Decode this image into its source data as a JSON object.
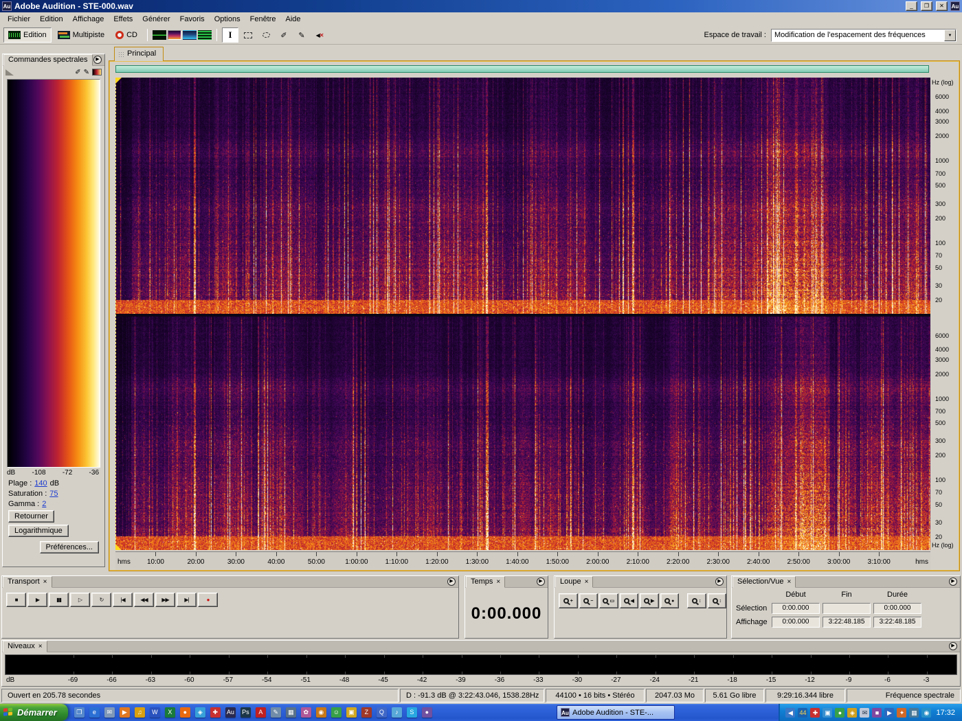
{
  "colors": {
    "frame_accent": "#c28a10",
    "range_bar_green": "#7fcab4",
    "selection_yellow": "#ffd820",
    "record_red": "#cc1111",
    "taskbar_blue": "#2c60d8",
    "start_green": "#2f8a2c",
    "spectro_palette": [
      "#040008",
      "#1c0430",
      "#44085c",
      "#8c1448",
      "#c82828",
      "#f07018",
      "#f8a820",
      "#ffd850",
      "#fff8dc"
    ]
  },
  "window": {
    "icon": "Au",
    "title": "Adobe Audition - STE-000.wav"
  },
  "icons": {
    "minimize": "_",
    "maximize": "❐",
    "close": "✕",
    "panel_menu": "▶",
    "tab_close": "×",
    "dropdown_arrow": "▼",
    "eyedropper_add": "✐",
    "eyedropper_remove": "✎",
    "transport": [
      {
        "name": "stop-button",
        "glyph": "■"
      },
      {
        "name": "play-button",
        "glyph": "▶"
      },
      {
        "name": "pause-button",
        "glyph": "▮▮"
      },
      {
        "name": "play-from-cursor-button",
        "glyph": "▷"
      },
      {
        "name": "play-looped-button",
        "glyph": "↻"
      },
      {
        "name": "go-to-beginning-button",
        "glyph": "|◀"
      },
      {
        "name": "rewind-button",
        "glyph": "◀◀"
      },
      {
        "name": "fast-forward-button",
        "glyph": "▶▶"
      },
      {
        "name": "go-to-end-button",
        "glyph": "▶|"
      },
      {
        "name": "record-button",
        "glyph": "●",
        "fg": "#cc1111"
      }
    ],
    "loupe": [
      {
        "name": "zoom-in-button",
        "sign": "+"
      },
      {
        "name": "zoom-out-button",
        "sign": "−"
      },
      {
        "name": "zoom-full-button",
        "sign": "▭"
      },
      {
        "name": "zoom-left-edge-button",
        "sign": "◀"
      },
      {
        "name": "zoom-right-edge-button",
        "sign": "▶"
      },
      {
        "name": "zoom-selection-button",
        "sign": "●"
      },
      {
        "name": "zoom-in-vertical-button",
        "sign": "↕"
      },
      {
        "name": "zoom-out-vertical-button",
        "sign": "↕"
      }
    ]
  },
  "menu": {
    "items": [
      "Fichier",
      "Edition",
      "Affichage",
      "Effets",
      "Générer",
      "Favoris",
      "Options",
      "Fenêtre",
      "Aide"
    ]
  },
  "toolbar": {
    "buttons": [
      "Edition",
      "Multipiste",
      "CD"
    ],
    "workspace_label": "Espace de travail :",
    "workspace_value": "Modification de l'espacement des fréquences"
  },
  "spectral_controls": {
    "title": "Commandes spectrales",
    "scale_labels": [
      "dB",
      "-108",
      "-72",
      "-36"
    ],
    "fields": [
      {
        "label": "Plage :",
        "value": "140",
        "suffix": "dB"
      },
      {
        "label": "Saturation :",
        "value": "75",
        "suffix": ""
      },
      {
        "label": "Gamma :",
        "value": "2",
        "suffix": ""
      }
    ],
    "buttons": [
      "Retourner",
      "Logarithmique",
      "Préférences..."
    ]
  },
  "main_view": {
    "tab": "Principal",
    "freq_axis_label": "Hz (log)",
    "freq_ticks": [
      "6000",
      "4000",
      "3000",
      "2000",
      "1000",
      "700",
      "500",
      "300",
      "200",
      "100",
      "70",
      "50",
      "30",
      "20"
    ],
    "time_ticks": [
      "10:00",
      "20:00",
      "30:00",
      "40:00",
      "50:00",
      "1:00:00",
      "1:10:00",
      "1:20:00",
      "1:30:00",
      "1:40:00",
      "1:50:00",
      "2:00:00",
      "2:10:00",
      "2:20:00",
      "2:30:00",
      "2:40:00",
      "2:50:00",
      "3:00:00",
      "3:10:00"
    ],
    "ruler_ends": "hms"
  },
  "panels": {
    "transport": {
      "title": "Transport"
    },
    "temps": {
      "title": "Temps",
      "value": "0:00.000"
    },
    "loupe": {
      "title": "Loupe"
    },
    "selection": {
      "title": "Sélection/Vue",
      "columns": [
        "Début",
        "Fin",
        "Durée"
      ],
      "rows": [
        {
          "label": "Sélection",
          "debut": "0:00.000",
          "fin": "",
          "duree": "0:00.000"
        },
        {
          "label": "Affichage",
          "debut": "0:00.000",
          "fin": "3:22:48.185",
          "duree": "3:22:48.185"
        }
      ]
    },
    "niveaux": {
      "title": "Niveaux",
      "scale": [
        "dB",
        "-69",
        "-66",
        "-63",
        "-60",
        "-57",
        "-54",
        "-51",
        "-48",
        "-45",
        "-42",
        "-39",
        "-36",
        "-33",
        "-30",
        "-27",
        "-24",
        "-21",
        "-18",
        "-15",
        "-12",
        "-9",
        "-6",
        "-3"
      ]
    }
  },
  "status_bar": {
    "items": [
      "Ouvert en 205.78 secondes",
      "D : -91.3 dB @ 3:22:43.046, 1538.28Hz",
      "44100 • 16 bits • Stéréo",
      "2047.03 Mo",
      "5.61 Go libre",
      "9:29:16.344 libre",
      "Fréquence spectrale"
    ]
  },
  "taskbar": {
    "start_label": "Démarrer",
    "task_label": "Adobe Audition - STE-...",
    "clock": "17:32",
    "quick_launch": [
      {
        "glyph": "❐",
        "bg": "#5588cc"
      },
      {
        "glyph": "e",
        "bg": "#2a6fd4"
      },
      {
        "glyph": "✉",
        "bg": "#8098b8"
      },
      {
        "glyph": "▶",
        "bg": "#e07820"
      },
      {
        "glyph": "♫",
        "bg": "#d8a010"
      },
      {
        "glyph": "W",
        "bg": "#2a52be"
      },
      {
        "glyph": "X",
        "bg": "#1a7a3a"
      },
      {
        "glyph": "●",
        "bg": "#e86a10"
      },
      {
        "glyph": "◈",
        "bg": "#38a0d8"
      },
      {
        "glyph": "✚",
        "bg": "#c83030"
      },
      {
        "glyph": "Au",
        "bg": "#2a2a50"
      },
      {
        "glyph": "Ps",
        "bg": "#1c3648"
      },
      {
        "glyph": "A",
        "bg": "#c02020"
      },
      {
        "glyph": "✎",
        "bg": "#708ca8"
      },
      {
        "glyph": "▦",
        "bg": "#5a7288"
      },
      {
        "glyph": "✿",
        "bg": "#b05898"
      },
      {
        "glyph": "◉",
        "bg": "#c87818"
      },
      {
        "glyph": "☺",
        "bg": "#38a048"
      },
      {
        "glyph": "▣",
        "bg": "#d0a820"
      },
      {
        "glyph": "Z",
        "bg": "#a03828"
      },
      {
        "glyph": "Q",
        "bg": "#4068c8"
      },
      {
        "glyph": "♪",
        "bg": "#58a8d8"
      },
      {
        "glyph": "S",
        "bg": "#28a8e0"
      },
      {
        "glyph": "●",
        "bg": "#7050a0"
      }
    ],
    "tray_icons": [
      {
        "glyph": "◀",
        "bg": "#3a78c8"
      },
      {
        "glyph": "44",
        "bg": "#1a62b0",
        "fg": "#ffd84a"
      },
      {
        "glyph": "✚",
        "bg": "#c83030"
      },
      {
        "glyph": "▣",
        "bg": "#3890d0"
      },
      {
        "glyph": "●",
        "bg": "#38a048"
      },
      {
        "glyph": "◈",
        "bg": "#d0a020"
      },
      {
        "glyph": "✉",
        "bg": "#c0c8d8",
        "fg": "#223044"
      },
      {
        "glyph": "■",
        "bg": "#8048a0"
      },
      {
        "glyph": "▶",
        "bg": "#2a68c0"
      },
      {
        "glyph": "✦",
        "bg": "#d06828"
      },
      {
        "glyph": "▦",
        "bg": "#487898"
      },
      {
        "glyph": "◉",
        "bg": "#2890c8"
      }
    ]
  }
}
